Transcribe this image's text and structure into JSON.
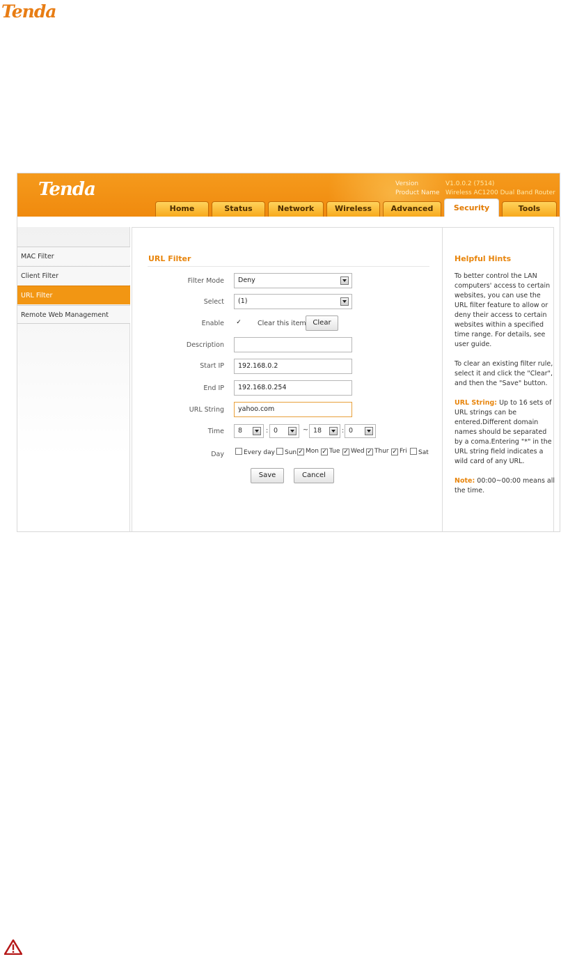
{
  "doc": {
    "logo_text": "Tenda"
  },
  "router": {
    "logo_text": "Tenda",
    "version_label": "Version",
    "version_value": "V1.0.0.2 (7514)",
    "product_label": "Product Name",
    "product_value": "Wireless AC1200 Dual Band Router"
  },
  "tabs": [
    {
      "label": "Home"
    },
    {
      "label": "Status"
    },
    {
      "label": "Network"
    },
    {
      "label": "Wireless"
    },
    {
      "label": "Advanced"
    },
    {
      "label": "Security"
    },
    {
      "label": "Tools"
    }
  ],
  "active_tab": "Security",
  "sidebar": {
    "items": [
      {
        "label": "MAC Filter"
      },
      {
        "label": "Client Filter"
      },
      {
        "label": "URL Filter"
      },
      {
        "label": "Remote Web Management"
      }
    ],
    "active": "URL Filter"
  },
  "form": {
    "title": "URL Filter",
    "filter_mode_label": "Filter Mode",
    "filter_mode_value": "Deny",
    "select_label": "Select",
    "select_value": "(1)",
    "enable_label": "Enable",
    "enable_checked": "✓",
    "clear_item_label": "Clear this item:",
    "clear_button": "Clear",
    "description_label": "Description",
    "description_value": "",
    "start_ip_label": "Start IP",
    "start_ip_value": "192.168.0.2",
    "end_ip_label": "End IP",
    "end_ip_value": "192.168.0.254",
    "url_string_label": "URL String",
    "url_string_value": "yahoo.com",
    "time_label": "Time",
    "time_start_hour": "8",
    "time_start_min": "0",
    "time_end_hour": "18",
    "time_end_min": "0",
    "time_colon": ":",
    "time_dash": "~",
    "day_label": "Day",
    "days": [
      {
        "label": "Every day",
        "mark": ""
      },
      {
        "label": "Sun",
        "mark": ""
      },
      {
        "label": "Mon",
        "mark": "✓"
      },
      {
        "label": "Tue",
        "mark": "✓"
      },
      {
        "label": "Wed",
        "mark": "✓"
      },
      {
        "label": "Thur",
        "mark": "✓"
      },
      {
        "label": "Fri",
        "mark": "✓"
      },
      {
        "label": "Sat",
        "mark": ""
      }
    ],
    "save_button": "Save",
    "cancel_button": "Cancel"
  },
  "hints": {
    "title": "Helpful Hints",
    "p1": "To better control the LAN computers' access to certain websites, you can use the URL filter feature to allow or deny their access to certain websites within a specified time range. For details, see user guide.",
    "p2": "To clear an existing filter rule, select it and click the \"Clear\", and then the \"Save\" button.",
    "p3_label": "URL String:",
    "p3_text": " Up to 16 sets of URL strings can be entered.Different domain names should be separated by a coma.Entering \"*\" in the URL string field indicates a wild card of any URL.",
    "p4_label": "Note:",
    "p4_text": " 00:00~00:00 means all the time."
  },
  "colors": {
    "accent": "#f29613",
    "header": "#f59a1c",
    "link": "#e8850c"
  }
}
